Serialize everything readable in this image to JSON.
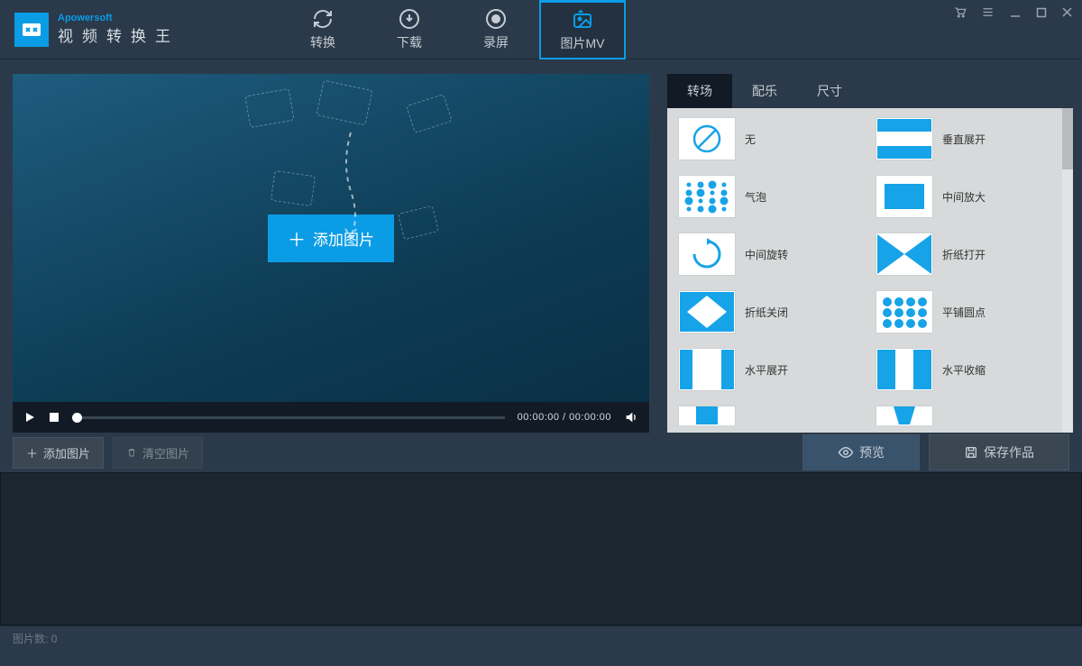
{
  "header": {
    "brand": "Apowersoft",
    "title": "视频转换王",
    "tabs": [
      {
        "label": "转换"
      },
      {
        "label": "下载"
      },
      {
        "label": "录屏"
      },
      {
        "label": "图片MV"
      }
    ]
  },
  "preview": {
    "add_button": "添加图片",
    "time_current": "00:00:00",
    "time_total": "00:00:00"
  },
  "side": {
    "tabs": [
      {
        "label": "转场"
      },
      {
        "label": "配乐"
      },
      {
        "label": "尺寸"
      }
    ],
    "effects": [
      {
        "label": "无",
        "type": "none"
      },
      {
        "label": "垂直展开",
        "type": "vstripe"
      },
      {
        "label": "气泡",
        "type": "bubbles"
      },
      {
        "label": "中间放大",
        "type": "zoom"
      },
      {
        "label": "中间旋转",
        "type": "rotate"
      },
      {
        "label": "折纸打开",
        "type": "bowtie"
      },
      {
        "label": "折纸关闭",
        "type": "diamondin"
      },
      {
        "label": "平铺圆点",
        "type": "dotgrid"
      },
      {
        "label": "水平展开",
        "type": "hexpand"
      },
      {
        "label": "水平收缩",
        "type": "hshrink"
      },
      {
        "label": "",
        "type": "partial1"
      },
      {
        "label": "",
        "type": "partial2"
      }
    ]
  },
  "toolbar": {
    "add_image": "添加图片",
    "clear_images": "清空图片",
    "preview": "预览",
    "save": "保存作品"
  },
  "status": {
    "image_count_label": "图片数:",
    "image_count": "0"
  }
}
